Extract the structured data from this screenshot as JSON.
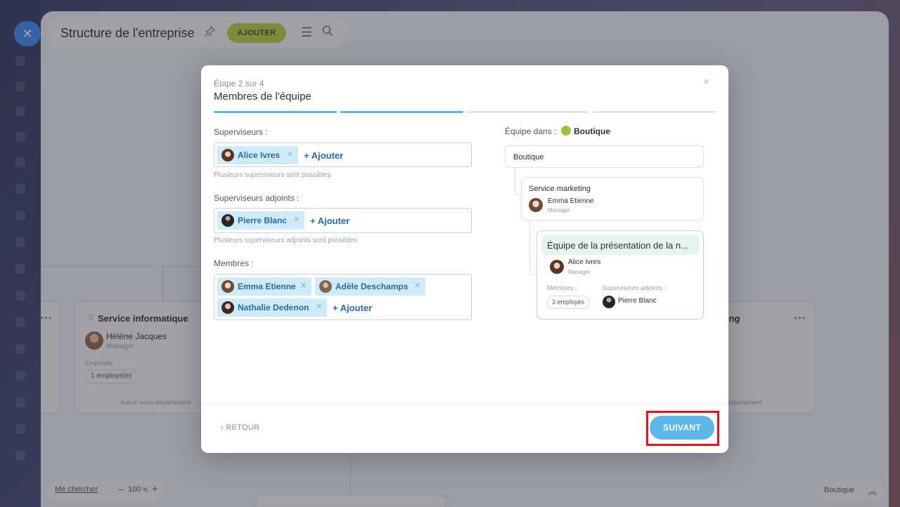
{
  "app": {
    "title": "Structure de l'entreprise",
    "add_button": "AJOUTER",
    "close_label": "✕"
  },
  "org": {
    "left_dept": {
      "name": "Service informatique",
      "person": "Hélène Jacques",
      "role": "Manager",
      "employees_label": "Employés",
      "employees_count": "1 employé(e)",
      "sub_departments": "Aucun sous-département"
    },
    "right_dept": {
      "name_fragment": "ing",
      "sub_departments_fragment": "département"
    }
  },
  "bottom": {
    "find_me": "Me chercher",
    "zoom_minus": "−",
    "zoom_value": "100",
    "zoom_unit": "%",
    "zoom_plus": "+",
    "location": "Boutique"
  },
  "modal": {
    "step": "Étape 2 sur 4",
    "title": "Membres de l'équipe",
    "close_label": "×",
    "progress": {
      "current": 2,
      "total": 4
    },
    "supervisors": {
      "label": "Superviseurs :",
      "chips": [
        "Alice Ivres"
      ],
      "add": "+ Ajouter",
      "hint": "Plusieurs superviseurs sont possibles"
    },
    "deputies": {
      "label": "Superviseurs adjoints :",
      "chips": [
        "Pierre Blanc"
      ],
      "add": "+ Ajouter",
      "hint": "Plusieurs superviseurs adjoints sont possibles"
    },
    "members": {
      "label": "Membres :",
      "chips": [
        "Emma Etienne",
        "Adèle Deschamps",
        "Nathalie Dedenon"
      ],
      "add": "+ Ajouter"
    },
    "tree": {
      "label": "Équipe dans :",
      "parent": "Boutique",
      "root": "Boutique",
      "marketing": {
        "title": "Service marketing",
        "person": "Emma Etienne",
        "role": "Manager"
      },
      "team": {
        "title": "Équipe de la présentation de la n...",
        "person": "Alice Ivres",
        "role": "Manager",
        "members_label": "Membres :",
        "members_count": "3 employés",
        "deputies_label": "Superviseurs adjoints :",
        "deputy": "Pierre Blanc"
      }
    },
    "back": "RETOUR",
    "next": "SUIVANT"
  },
  "colors": {
    "accent_blue": "#5db7e8",
    "add_green": "#b7d241",
    "chip_bg": "#cfeaf9",
    "highlight": "#e8141b"
  }
}
